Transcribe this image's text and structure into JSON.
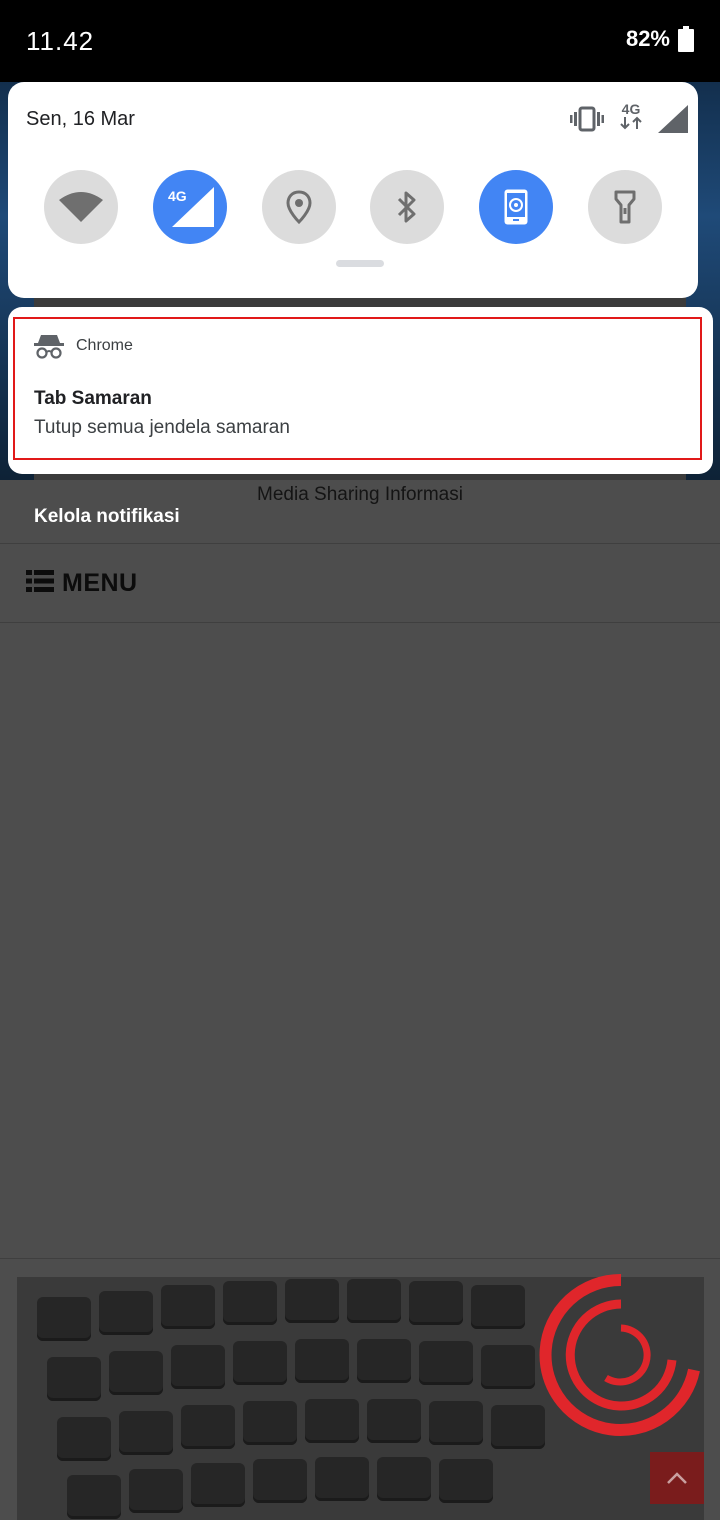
{
  "status_bar": {
    "time": "11.42",
    "battery_percent": "82%",
    "battery_icon": "battery-full-icon"
  },
  "quick_settings": {
    "date": "Sen, 16 Mar",
    "network_type": "4G",
    "status_icons": [
      "vibrate-icon",
      "mobile-data-arrows-icon",
      "signal-icon"
    ],
    "tiles": [
      {
        "name": "wifi",
        "icon": "wifi-icon",
        "active": false
      },
      {
        "name": "mobile-data",
        "icon": "mobile-data-4g-icon",
        "label": "4G",
        "active": true
      },
      {
        "name": "location",
        "icon": "location-pin-icon",
        "active": false
      },
      {
        "name": "bluetooth",
        "icon": "bluetooth-icon",
        "active": false
      },
      {
        "name": "auto-rotate",
        "icon": "auto-rotate-icon",
        "active": true
      },
      {
        "name": "flashlight",
        "icon": "flashlight-icon",
        "active": false
      }
    ],
    "accent_color": "#4285f4",
    "inactive_color": "#dcdcdc"
  },
  "notification": {
    "app_icon": "incognito-icon",
    "app_name": "Chrome",
    "title": "Tab Samaran",
    "text": "Tutup semua jendela samaran",
    "highlight_color": "#e11919"
  },
  "shade_footer": {
    "manage_label": "Kelola notifikasi"
  },
  "background_page": {
    "tagline": "Media Sharing Informasi",
    "menu_icon": "list-menu-icon",
    "menu_label": "MENU",
    "scroll_top_icon": "chevron-up-icon"
  }
}
